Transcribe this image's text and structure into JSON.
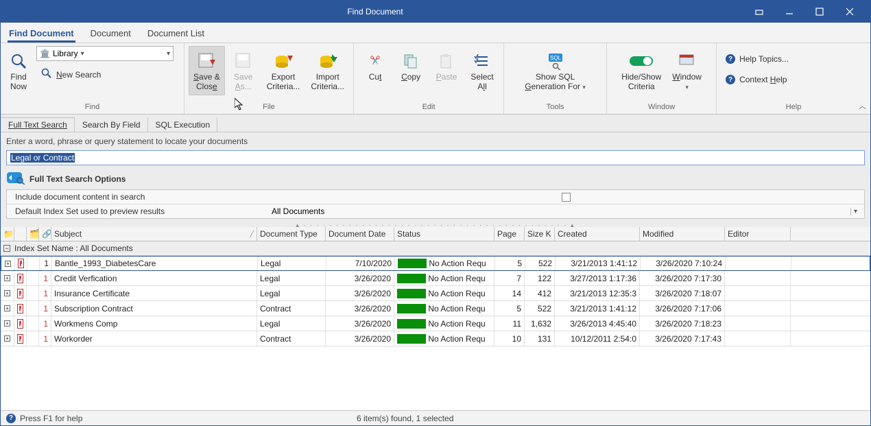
{
  "window": {
    "title": "Find Document"
  },
  "menutabs": {
    "find_document": "Find Document",
    "document": "Document",
    "document_list": "Document List"
  },
  "ribbon": {
    "find": {
      "label": "Find",
      "library_label": "Library",
      "find_now": "Find\nNow",
      "new_search": "New Search"
    },
    "file": {
      "label": "File",
      "save_close": "Save &\nClose",
      "save_as": "Save\nAs...",
      "export_criteria": "Export\nCriteria...",
      "import_criteria": "Import\nCriteria..."
    },
    "edit": {
      "label": "Edit",
      "cut": "Cut",
      "copy": "Copy",
      "paste": "Paste",
      "select_all": "Select\nAll"
    },
    "tools": {
      "label": "Tools",
      "show_sql": "Show SQL\nGeneration For"
    },
    "criteria_grp": {
      "hide_show": "Hide/Show\nCriteria"
    },
    "window_grp": {
      "label": "Window",
      "window": "Window"
    },
    "help": {
      "label": "Help",
      "help_topics": "Help Topics...",
      "context_help": "Context Help"
    }
  },
  "search": {
    "tabs": {
      "full_text": "Full Text Search",
      "by_field": "Search By Field",
      "sql": "SQL Execution"
    },
    "hint": "Enter a word, phrase or query statement to locate your documents",
    "query": "Legal or Contract",
    "options_header": "Full Text Search Options",
    "opt_include_content": "Include document content in search",
    "opt_default_index": "Default Index Set used to preview results",
    "default_index_value": "All Documents"
  },
  "grid": {
    "headers": {
      "subject": "Subject",
      "doc_type": "Document Type",
      "doc_date": "Document Date",
      "status": "Status",
      "pages": "Page",
      "size": "Size K",
      "created": "Created",
      "modified": "Modified",
      "editor": "Editor"
    },
    "group_label": "Index Set Name : All Documents",
    "rows": [
      {
        "num": "1",
        "subject": "Bantle_1993_DiabetesCare",
        "type": "Legal",
        "date": "7/10/2020",
        "status": "No Action Requ",
        "pages": "5",
        "size": "522",
        "created": "3/21/2013 1:41:12",
        "modified": "3/26/2020 7:10:24",
        "selected": true
      },
      {
        "num": "1",
        "subject": "Credit Verfication",
        "type": "Legal",
        "date": "3/26/2020",
        "status": "No Action Requ",
        "pages": "7",
        "size": "122",
        "created": "3/27/2013 1:17:36",
        "modified": "3/26/2020 7:17:30"
      },
      {
        "num": "1",
        "subject": "Insurance Certificate",
        "type": "Legal",
        "date": "3/26/2020",
        "status": "No Action Requ",
        "pages": "14",
        "size": "412",
        "created": "3/21/2013 12:35:3",
        "modified": "3/26/2020 7:18:07"
      },
      {
        "num": "1",
        "subject": "Subscription Contract",
        "type": "Contract",
        "date": "3/26/2020",
        "status": "No Action Requ",
        "pages": "5",
        "size": "522",
        "created": "3/21/2013 1:41:12",
        "modified": "3/26/2020 7:17:06"
      },
      {
        "num": "1",
        "subject": "Workmens Comp",
        "type": "Legal",
        "date": "3/26/2020",
        "status": "No Action Requ",
        "pages": "11",
        "size": "1,632",
        "created": "3/26/2013 4:45:40",
        "modified": "3/26/2020 7:18:23"
      },
      {
        "num": "1",
        "subject": "Workorder",
        "type": "Contract",
        "date": "3/26/2020",
        "status": "No Action Requ",
        "pages": "10",
        "size": "131",
        "created": "10/12/2011 2:54:0",
        "modified": "3/26/2020 7:17:43"
      }
    ]
  },
  "statusbar": {
    "help": "Press F1 for help",
    "summary": "6 item(s) found, 1 selected"
  },
  "col_widths": {
    "exp": 20,
    "ico": 18,
    "attch": 18,
    "link": 18,
    "subject": 300,
    "type": 100,
    "date": 100,
    "status": 146,
    "pages": 44,
    "size": 44,
    "created": 124,
    "modified": 124,
    "editor": 96
  }
}
